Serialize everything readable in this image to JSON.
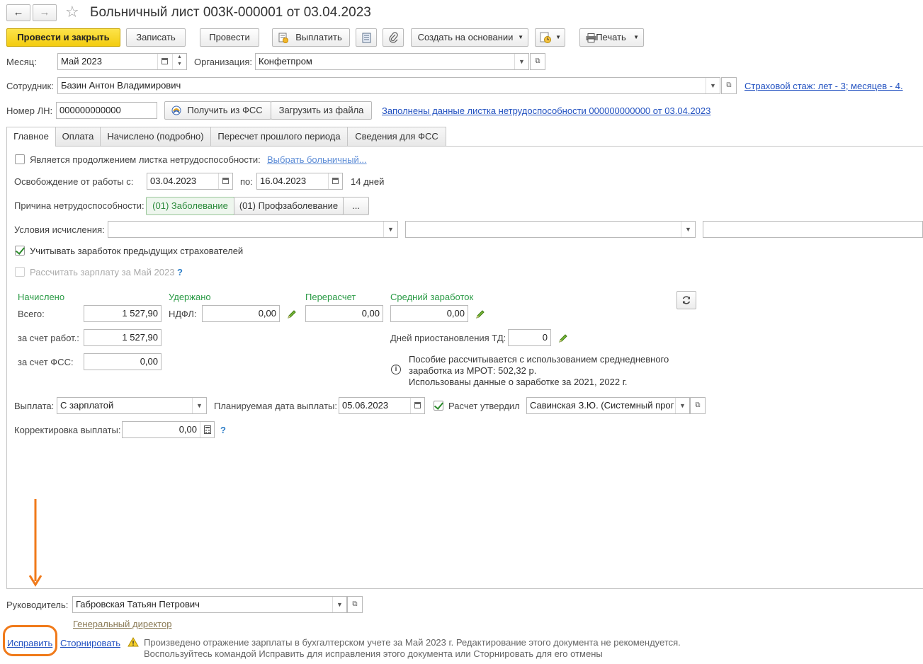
{
  "window": {
    "title": "Больничный лист 003К-000001 от 03.04.2023",
    "nav_back": "←",
    "nav_forward": "→",
    "favorite": "☆"
  },
  "toolbar": {
    "post_close": "Провести и закрыть",
    "save": "Записать",
    "post": "Провести",
    "pay": "Выплатить",
    "create_based": "Создать на основании",
    "print": "Печать"
  },
  "header": {
    "month_label": "Месяц:",
    "month_value": "Май 2023",
    "org_label": "Организация:",
    "org_value": "Конфетпром",
    "employee_label": "Сотрудник:",
    "employee_value": "Базин Антон Владимирович",
    "insurance_link": "Страховой стаж: лет - 3; месяцев - 4.",
    "ln_label": "Номер ЛН:",
    "ln_value": "000000000000",
    "get_fss": "Получить из ФСС",
    "load_file": "Загрузить из файла",
    "ln_filled_link": "Заполнены данные листка нетрудоспособности 000000000000 от 03.04.2023"
  },
  "tabs": [
    {
      "label": "Главное",
      "active": true
    },
    {
      "label": "Оплата",
      "active": false
    },
    {
      "label": "Начислено (подробно)",
      "active": false
    },
    {
      "label": "Пересчет прошлого периода",
      "active": false
    },
    {
      "label": "Сведения для ФСС",
      "active": false
    }
  ],
  "main": {
    "continuation_label": "Является продолжением листка нетрудоспособности:",
    "choose_sick_link": "Выбрать больничный...",
    "release_label": "Освобождение от работы с:",
    "date_from": "03.04.2023",
    "to_label": "по:",
    "date_to": "16.04.2023",
    "days": "14 дней",
    "cause_label": "Причина нетрудоспособности:",
    "cause_disease": "(01) Заболевание",
    "cause_prof": "(01) Профзаболевание",
    "cause_more": "...",
    "conditions_label": "Условия исчисления:",
    "consider_prev_label": "Учитывать заработок предыдущих страхователей",
    "consider_prev_checked": true,
    "calc_salary_label": "Рассчитать зарплату за Май 2023",
    "calc_salary_checked": false,
    "hint_q": "?"
  },
  "amounts": {
    "accrued_header": "Начислено",
    "withheld_header": "Удержано",
    "recalc_header": "Перерасчет",
    "avg_header": "Средний заработок",
    "total_label": "Всего:",
    "total_value": "1 527,90",
    "ndfl_label": "НДФЛ:",
    "ndfl_value": "0,00",
    "recalc_value": "0,00",
    "avg_value": "0,00",
    "employer_label": "за счет работ.:",
    "employer_value": "1 527,90",
    "suspension_label": "Дней приостановления ТД:",
    "suspension_value": "0",
    "fss_label": "за счет ФСС:",
    "fss_value": "0,00",
    "info_line1": "Пособие рассчитывается с использованием среднедневного",
    "info_line2": "заработка из МРОТ: 502,32 р.",
    "info_line3": "Использованы данные о заработке за  2021,  2022 г."
  },
  "payment": {
    "payout_label": "Выплата:",
    "payout_value": "С зарплатой",
    "planned_date_label": "Планируемая дата выплаты:",
    "planned_date_value": "05.06.2023",
    "approved_label": "Расчет утвердил",
    "approved_checked": true,
    "approved_value": "Савинская З.Ю. (Системный прог",
    "correction_label": "Корректировка выплаты:",
    "correction_value": "0,00"
  },
  "footer": {
    "head_label": "Руководитель:",
    "head_value": "Габровская Татьян Петрович",
    "head_position": "Генеральный директор",
    "fix_link": "Исправить",
    "reverse_link": "Сторнировать",
    "warning_line1": "Произведено отражение зарплаты в бухгалтерском учете за Май 2023 г. Редактирование этого документа не рекомендуется.",
    "warning_line2": "Воспользуйтесь командой Исправить для исправления этого документа или Сторнировать для его отмены"
  },
  "colors": {
    "accent_orange": "#f07a1a",
    "link_blue": "#2050c0",
    "header_green": "#2a9a45",
    "yellow_button": "#f3cc10"
  }
}
